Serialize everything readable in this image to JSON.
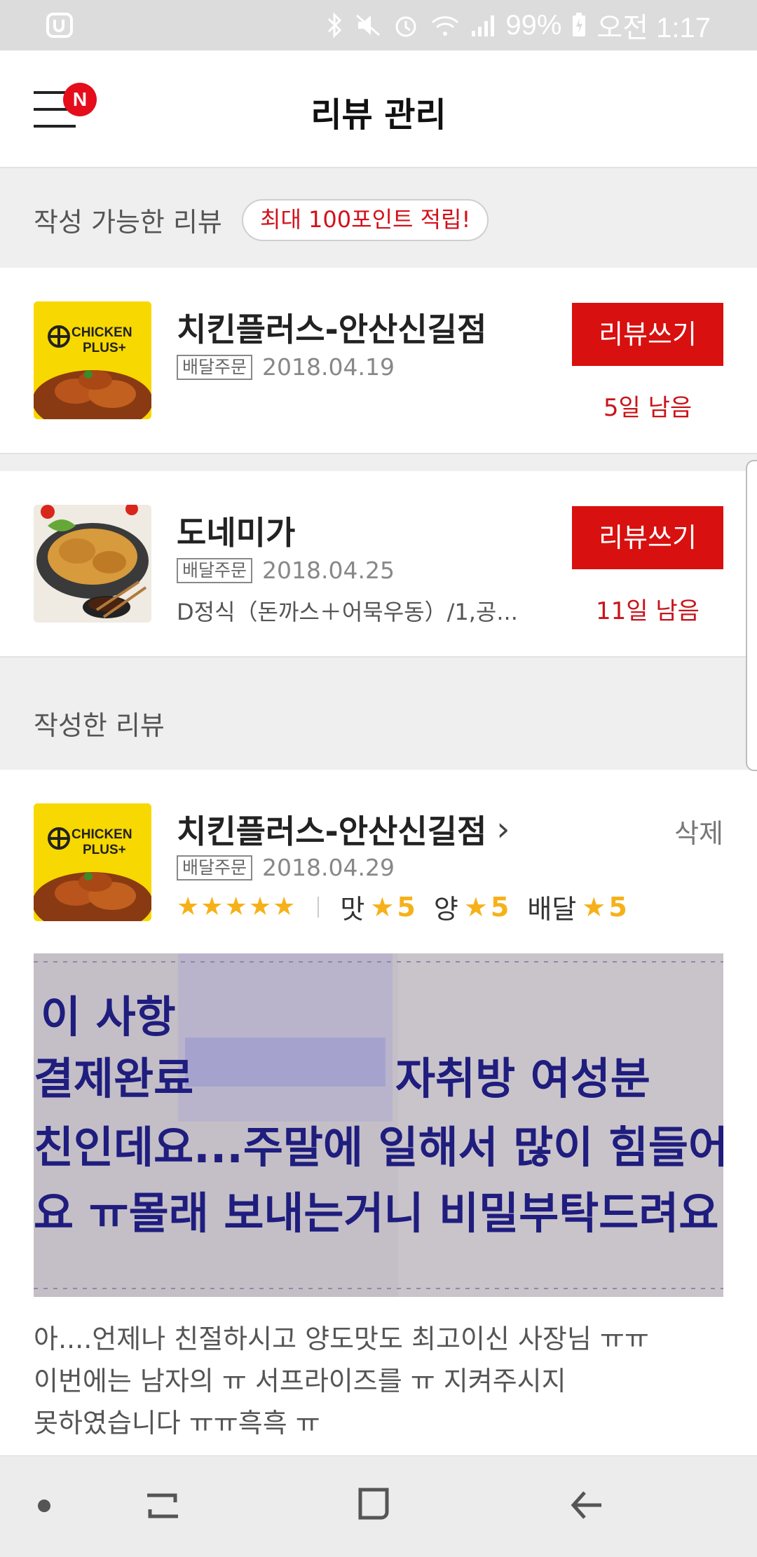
{
  "status_bar": {
    "battery": "99%",
    "time": "오전 1:17"
  },
  "app_bar": {
    "title": "리뷰 관리",
    "menu_badge": "N"
  },
  "writable_section": {
    "title": "작성 가능한 리뷰",
    "promo": "최대 100포인트 적립!"
  },
  "writable_reviews": [
    {
      "store": "치킨플러스-안산신길점",
      "order_type": "배달주문",
      "date": "2018.04.19",
      "button": "리뷰쓰기",
      "remaining": "5일 남음",
      "logo_text": [
        "CHICKEN",
        "PLUS+"
      ]
    },
    {
      "store": "도네미가",
      "order_type": "배달주문",
      "date": "2018.04.25",
      "menu": "D정식（돈까스＋어묵우동）/1,공...",
      "button": "리뷰쓰기",
      "remaining": "11일 남음"
    }
  ],
  "written_section": {
    "title": "작성한 리뷰"
  },
  "written_review": {
    "store": "치킨플러스-안산신길점",
    "chevron": "›",
    "delete": "삭제",
    "order_type": "배달주문",
    "date": "2018.04.29",
    "stars": "★★★★★",
    "ratings": [
      {
        "label": "맛",
        "value": "5"
      },
      {
        "label": "양",
        "value": "5"
      },
      {
        "label": "배달",
        "value": "5"
      }
    ],
    "photo_text": [
      "이 사항",
      "결제완료",
      "자취방 여성분",
      "친인데요...주말에 일해서 많이 힘들어하",
      "요 ㅠ몰래 보내는거니 비밀부탁드려요 ㅋ"
    ],
    "text_lines": [
      "아....언제나 친절하시고 양도맛도 최고이신 사장님 ㅠㅠ",
      "이번에는 남자의 ㅠ 서프라이즈를 ㅠ 지켜주시지",
      "못하였습니다 ㅠㅠ흑흑 ㅠ"
    ]
  },
  "colors": {
    "accent_red": "#d8100f",
    "star_gold": "#f6b11a",
    "logo_yellow": "#f7d800"
  }
}
